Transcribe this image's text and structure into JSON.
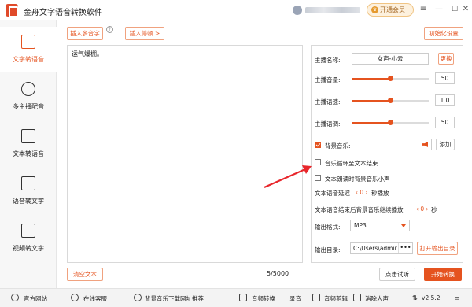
{
  "app": {
    "title": "金舟文字语音转换软件",
    "version": "v2.5.2"
  },
  "header": {
    "vip_label": "开通会员",
    "min_icon": "—",
    "max_icon": "☐",
    "close_icon": "✕",
    "menu_icon": "≡"
  },
  "sidebar": {
    "items": [
      {
        "label": "文字转语音",
        "active": true,
        "icon": "text-to-speech-icon"
      },
      {
        "label": "多主播配音",
        "active": false,
        "icon": "user-icon"
      },
      {
        "label": "文本转语音",
        "active": false,
        "icon": "document-icon"
      },
      {
        "label": "语音转文字",
        "active": false,
        "icon": "audio-to-text-icon"
      },
      {
        "label": "视频转文字",
        "active": false,
        "icon": "video-to-text-icon"
      }
    ]
  },
  "toolbar": {
    "insert_multi_voice": "插入多音字",
    "help": "?",
    "insert_pause": "插入停顿 >",
    "reset_settings": "初始化设置"
  },
  "editor": {
    "content": "运气爆棚。",
    "char_count": "5/5000",
    "clear_label": "清空文本"
  },
  "settings": {
    "voice_label": "主播名称:",
    "voice_value": "女声-小云",
    "change_label": "更换",
    "volume_label": "主播音量:",
    "volume_value": "50",
    "volume_fraction": 0.5,
    "speed_label": "主播语速:",
    "speed_value": "1.0",
    "speed_fraction": 0.5,
    "pitch_label": "主播语调:",
    "pitch_value": "50",
    "pitch_fraction": 0.5,
    "bgm_label": "背景音乐:",
    "bgm_add": "添加",
    "bgm_checked": true,
    "loop_label": "音乐循环至文本结束",
    "loop_checked": false,
    "duck_label": "文本朗读时背景音乐小声",
    "duck_checked": false,
    "delay_prefix": "文本语音延迟",
    "delay_value": "0",
    "delay_suffix": "秒播放",
    "tail_prefix": "文本语音结束后背景音乐继续播放",
    "tail_value": "0",
    "tail_suffix": "秒",
    "format_label": "输出格式:",
    "format_value": "MP3",
    "dir_label": "输出目录:",
    "dir_value": "C:\\Users\\admir",
    "dir_dots": "•••",
    "open_dir": "打开输出目录"
  },
  "actions": {
    "preview": "点击试听",
    "start": "开始转换"
  },
  "footer": {
    "website": "官方网站",
    "support": "在线客服",
    "bgm_sites": "背景音乐下载网址推荐",
    "audio_convert": "音频转换",
    "record": "录音",
    "audio_cut": "音频剪辑",
    "vocal_remove": "消除人声"
  },
  "colors": {
    "accent": "#e5531f",
    "annotation": "#e8262b"
  }
}
